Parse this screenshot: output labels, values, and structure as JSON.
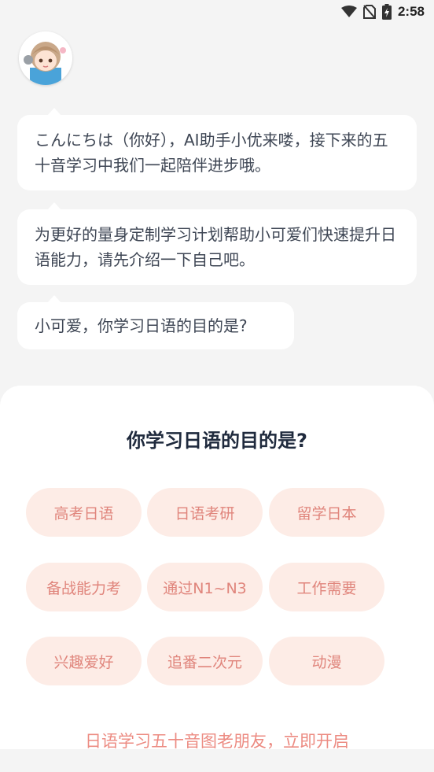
{
  "status_bar": {
    "time": "2:58",
    "icons": [
      "wifi-icon",
      "no-sim-icon",
      "battery-charging-icon"
    ]
  },
  "avatar": {
    "icon": "girl-avatar-icon"
  },
  "chat": {
    "messages": [
      {
        "text": "こんにちは（你好），AI助手小优来喽，接下来的五十音学习中我们一起陪伴进步哦。"
      },
      {
        "text": "为更好的量身定制学习计划帮助小可爱们快速提升日语能力，请先介绍一下自己吧。"
      },
      {
        "text": "小可爱，你学习日语的目的是?"
      }
    ]
  },
  "sheet": {
    "title": "你学习日语的目的是?",
    "options": [
      "高考日语",
      "日语考研",
      "留学日本",
      "备战能力考",
      "通过N1~N3",
      "工作需要",
      "兴趣爱好",
      "追番二次元",
      "动漫"
    ],
    "footer_link": "日语学习五十音图老朋友，立即开启"
  },
  "colors": {
    "option_bg": "#fdece6",
    "option_text": "#e0857c",
    "accent_link": "#ec8b82",
    "title": "#1f2a3d"
  }
}
